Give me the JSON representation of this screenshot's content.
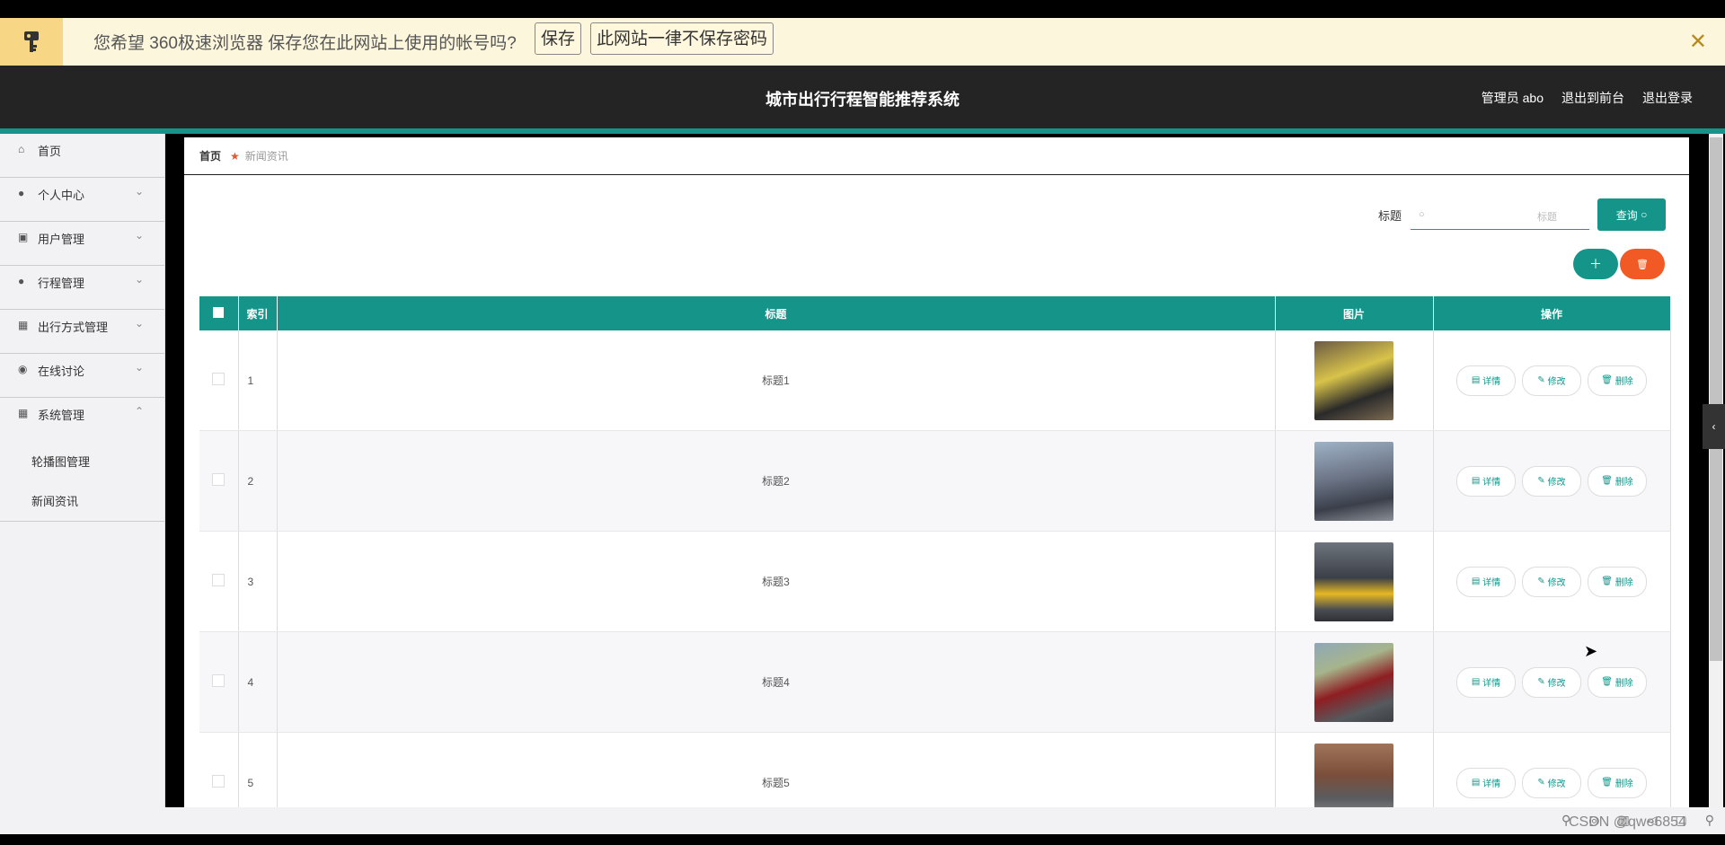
{
  "password_bar": {
    "message": "您希望 360极速浏览器 保存您在此网站上使用的帐号吗?",
    "save_label": "保存",
    "never_label": "此网站一律不保存密码",
    "close_glyph": "✕"
  },
  "header": {
    "title": "城市出行行程智能推荐系统",
    "admin": "管理员 abo",
    "to_front": "退出到前台",
    "logout": "退出登录"
  },
  "sidebar": {
    "items": [
      {
        "label": "首页",
        "icon": "home-icon"
      },
      {
        "label": "个人中心",
        "icon": "user-icon"
      },
      {
        "label": "用户管理",
        "icon": "chart-icon"
      },
      {
        "label": "行程管理",
        "icon": "user-icon"
      },
      {
        "label": "出行方式管理",
        "icon": "grid-icon"
      },
      {
        "label": "在线讨论",
        "icon": "mic-icon"
      },
      {
        "label": "系统管理",
        "icon": "apps-icon"
      }
    ],
    "sub_items": [
      "轮播图管理",
      "新闻资讯"
    ]
  },
  "breadcrumb": {
    "home": "首页",
    "current": "新闻资讯"
  },
  "search": {
    "label": "标题",
    "placeholder": "标题",
    "button": "查询"
  },
  "table": {
    "headers": [
      "索引",
      "标题",
      "图片",
      "操作"
    ],
    "rows": [
      {
        "index": "1",
        "title": "标题1"
      },
      {
        "index": "2",
        "title": "标题2"
      },
      {
        "index": "3",
        "title": "标题3"
      },
      {
        "index": "4",
        "title": "标题4"
      },
      {
        "index": "5",
        "title": "标题5"
      }
    ],
    "op_detail": "详情",
    "op_edit": "修改",
    "op_delete": "删除"
  },
  "watermark": "CSDN @qwe6854",
  "colors": {
    "teal": "#15958a",
    "orange": "#f15a24",
    "header": "#242424"
  }
}
